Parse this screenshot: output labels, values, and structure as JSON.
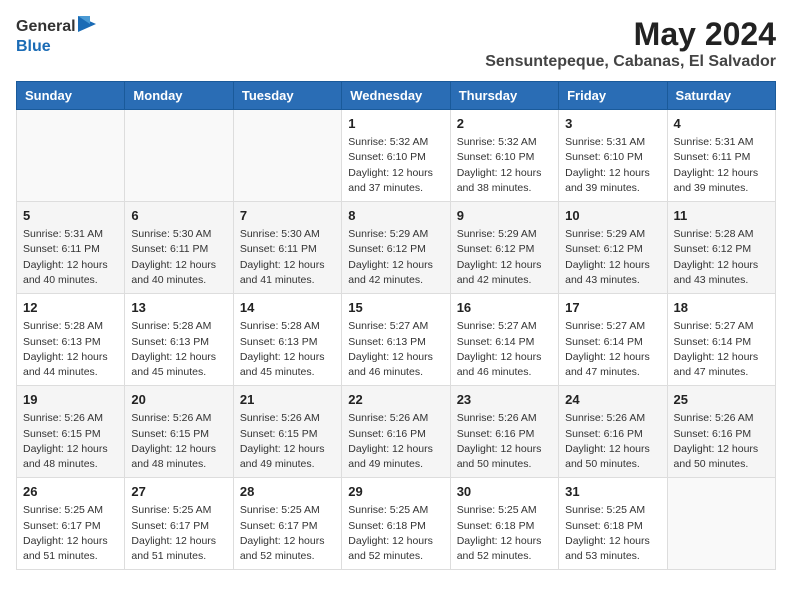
{
  "header": {
    "logo_general": "General",
    "logo_blue": "Blue",
    "title": "May 2024",
    "location": "Sensuntepeque, Cabanas, El Salvador"
  },
  "weekdays": [
    "Sunday",
    "Monday",
    "Tuesday",
    "Wednesday",
    "Thursday",
    "Friday",
    "Saturday"
  ],
  "weeks": [
    [
      {
        "day": "",
        "info": ""
      },
      {
        "day": "",
        "info": ""
      },
      {
        "day": "",
        "info": ""
      },
      {
        "day": "1",
        "info": "Sunrise: 5:32 AM\nSunset: 6:10 PM\nDaylight: 12 hours and 37 minutes."
      },
      {
        "day": "2",
        "info": "Sunrise: 5:32 AM\nSunset: 6:10 PM\nDaylight: 12 hours and 38 minutes."
      },
      {
        "day": "3",
        "info": "Sunrise: 5:31 AM\nSunset: 6:10 PM\nDaylight: 12 hours and 39 minutes."
      },
      {
        "day": "4",
        "info": "Sunrise: 5:31 AM\nSunset: 6:11 PM\nDaylight: 12 hours and 39 minutes."
      }
    ],
    [
      {
        "day": "5",
        "info": "Sunrise: 5:31 AM\nSunset: 6:11 PM\nDaylight: 12 hours and 40 minutes."
      },
      {
        "day": "6",
        "info": "Sunrise: 5:30 AM\nSunset: 6:11 PM\nDaylight: 12 hours and 40 minutes."
      },
      {
        "day": "7",
        "info": "Sunrise: 5:30 AM\nSunset: 6:11 PM\nDaylight: 12 hours and 41 minutes."
      },
      {
        "day": "8",
        "info": "Sunrise: 5:29 AM\nSunset: 6:12 PM\nDaylight: 12 hours and 42 minutes."
      },
      {
        "day": "9",
        "info": "Sunrise: 5:29 AM\nSunset: 6:12 PM\nDaylight: 12 hours and 42 minutes."
      },
      {
        "day": "10",
        "info": "Sunrise: 5:29 AM\nSunset: 6:12 PM\nDaylight: 12 hours and 43 minutes."
      },
      {
        "day": "11",
        "info": "Sunrise: 5:28 AM\nSunset: 6:12 PM\nDaylight: 12 hours and 43 minutes."
      }
    ],
    [
      {
        "day": "12",
        "info": "Sunrise: 5:28 AM\nSunset: 6:13 PM\nDaylight: 12 hours and 44 minutes."
      },
      {
        "day": "13",
        "info": "Sunrise: 5:28 AM\nSunset: 6:13 PM\nDaylight: 12 hours and 45 minutes."
      },
      {
        "day": "14",
        "info": "Sunrise: 5:28 AM\nSunset: 6:13 PM\nDaylight: 12 hours and 45 minutes."
      },
      {
        "day": "15",
        "info": "Sunrise: 5:27 AM\nSunset: 6:13 PM\nDaylight: 12 hours and 46 minutes."
      },
      {
        "day": "16",
        "info": "Sunrise: 5:27 AM\nSunset: 6:14 PM\nDaylight: 12 hours and 46 minutes."
      },
      {
        "day": "17",
        "info": "Sunrise: 5:27 AM\nSunset: 6:14 PM\nDaylight: 12 hours and 47 minutes."
      },
      {
        "day": "18",
        "info": "Sunrise: 5:27 AM\nSunset: 6:14 PM\nDaylight: 12 hours and 47 minutes."
      }
    ],
    [
      {
        "day": "19",
        "info": "Sunrise: 5:26 AM\nSunset: 6:15 PM\nDaylight: 12 hours and 48 minutes."
      },
      {
        "day": "20",
        "info": "Sunrise: 5:26 AM\nSunset: 6:15 PM\nDaylight: 12 hours and 48 minutes."
      },
      {
        "day": "21",
        "info": "Sunrise: 5:26 AM\nSunset: 6:15 PM\nDaylight: 12 hours and 49 minutes."
      },
      {
        "day": "22",
        "info": "Sunrise: 5:26 AM\nSunset: 6:16 PM\nDaylight: 12 hours and 49 minutes."
      },
      {
        "day": "23",
        "info": "Sunrise: 5:26 AM\nSunset: 6:16 PM\nDaylight: 12 hours and 50 minutes."
      },
      {
        "day": "24",
        "info": "Sunrise: 5:26 AM\nSunset: 6:16 PM\nDaylight: 12 hours and 50 minutes."
      },
      {
        "day": "25",
        "info": "Sunrise: 5:26 AM\nSunset: 6:16 PM\nDaylight: 12 hours and 50 minutes."
      }
    ],
    [
      {
        "day": "26",
        "info": "Sunrise: 5:25 AM\nSunset: 6:17 PM\nDaylight: 12 hours and 51 minutes."
      },
      {
        "day": "27",
        "info": "Sunrise: 5:25 AM\nSunset: 6:17 PM\nDaylight: 12 hours and 51 minutes."
      },
      {
        "day": "28",
        "info": "Sunrise: 5:25 AM\nSunset: 6:17 PM\nDaylight: 12 hours and 52 minutes."
      },
      {
        "day": "29",
        "info": "Sunrise: 5:25 AM\nSunset: 6:18 PM\nDaylight: 12 hours and 52 minutes."
      },
      {
        "day": "30",
        "info": "Sunrise: 5:25 AM\nSunset: 6:18 PM\nDaylight: 12 hours and 52 minutes."
      },
      {
        "day": "31",
        "info": "Sunrise: 5:25 AM\nSunset: 6:18 PM\nDaylight: 12 hours and 53 minutes."
      },
      {
        "day": "",
        "info": ""
      }
    ]
  ]
}
